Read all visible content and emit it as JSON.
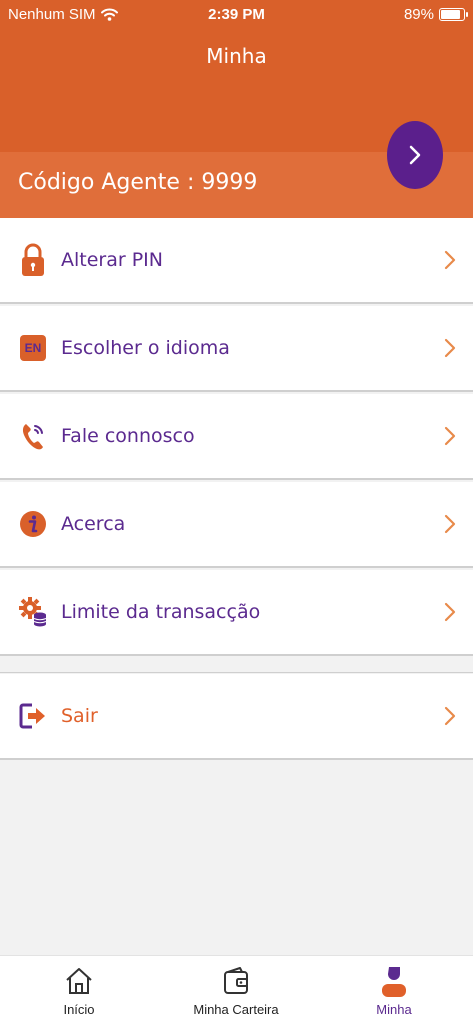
{
  "status_bar": {
    "carrier": "Nenhum SIM",
    "time": "2:39 PM",
    "battery": "89%",
    "battery_level": 0.89
  },
  "header": {
    "title": "Minha",
    "agent_code": "Código Agente : 9999"
  },
  "menu": [
    {
      "label": "Alterar PIN",
      "icon": "lock-icon"
    },
    {
      "label": "Escolher o idioma",
      "icon": "language-icon",
      "icon_text": "EN"
    },
    {
      "label": "Fale connosco",
      "icon": "phone-icon"
    },
    {
      "label": "Acerca",
      "icon": "info-icon"
    },
    {
      "label": "Limite da transacção",
      "icon": "gear-coins-icon"
    }
  ],
  "logout": {
    "label": "Sair",
    "icon": "logout-icon"
  },
  "tabs": [
    {
      "label": "Início",
      "icon": "home-icon",
      "active": false
    },
    {
      "label": "Minha Carteira",
      "icon": "wallet-icon",
      "active": false
    },
    {
      "label": "Minha",
      "icon": "profile-icon",
      "active": true
    }
  ],
  "colors": {
    "brand_orange": "#d9602a",
    "band_orange": "#e06e3a",
    "brand_purple": "#5b1f8c",
    "text_purple": "#5b2a8f",
    "chevron_orange": "#e88a4a"
  }
}
